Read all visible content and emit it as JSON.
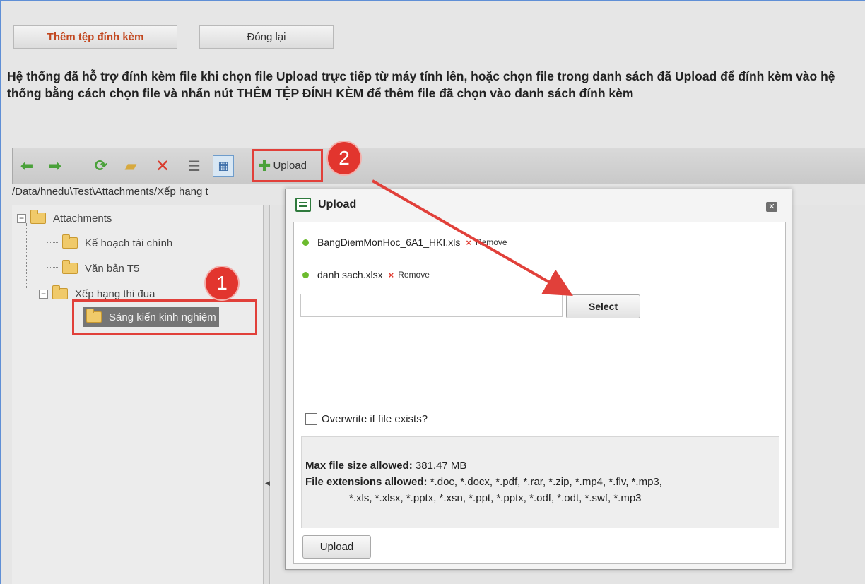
{
  "top_buttons": {
    "add_attachment": "Thêm tệp đính kèm",
    "close": "Đóng lại"
  },
  "notice": "Hệ thống đã hỗ trợ đính kèm file khi chọn file Upload trực tiếp từ máy tính lên, hoặc chọn file trong danh sách đã Upload để đính kèm vào hệ thống bằng cách chọn file và nhấn nút THÊM TỆP ĐÍNH KÈM để thêm file đã chọn vào danh sách đính kèm",
  "toolbar": {
    "upload_label": "Upload",
    "icons": [
      "back-arrow-icon",
      "forward-arrow-icon",
      "refresh-icon",
      "new-folder-icon",
      "delete-icon",
      "list-view-icon",
      "grid-view-icon",
      "upload-icon"
    ]
  },
  "path": "/Data/hnedu\\Test\\Attachments/Xếp hạng t",
  "tree": {
    "root": "Attachments",
    "children": [
      {
        "label": "Kế hoạch tài chính"
      },
      {
        "label": "Văn bản T5"
      },
      {
        "label": "Xếp hạng thi đua"
      }
    ],
    "selected": "Sáng kiến kinh nghiệm"
  },
  "badges": {
    "one": "1",
    "two": "2"
  },
  "dialog": {
    "title": "Upload",
    "files": [
      {
        "name": "BangDiemMonHoc_6A1_HKI.xls",
        "remove": "Remove"
      },
      {
        "name": "danh sach.xlsx",
        "remove": "Remove"
      }
    ],
    "file_input_value": "",
    "select_label": "Select",
    "overwrite_label": "Overwrite if file exists?",
    "max_size_label": "Max file size allowed:",
    "max_size_value": "381.47 MB",
    "ext_label": "File extensions allowed:",
    "ext_line1": "*.doc, *.docx, *.pdf, *.rar, *.zip, *.mp4, *.flv, *.mp3,",
    "ext_line2": "*.xls, *.xlsx, *.pptx, *.xsn, *.ppt, *.pptx, *.odf, *.odt, *.swf, *.mp3",
    "upload_label": "Upload"
  },
  "colors": {
    "accent_red": "#e1403a",
    "add_button_text": "#c2471f",
    "frame_border": "#5f8fd6",
    "file_dot": "#6cbb2e"
  }
}
